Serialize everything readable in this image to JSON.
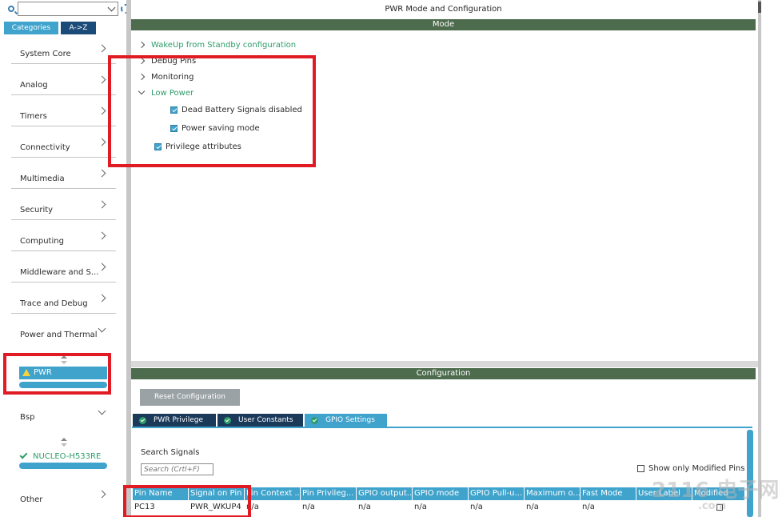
{
  "left": {
    "tabs": [
      "Categories",
      "A->Z"
    ],
    "categories": [
      "System Core",
      "Analog",
      "Timers",
      "Connectivity",
      "Multimedia",
      "Security",
      "Computing",
      "Middleware and S...",
      "Trace and Debug",
      "Power and Thermal"
    ],
    "selected": "PWR",
    "bsp": "Bsp",
    "board": "NUCLEO-H533RE",
    "other": "Other"
  },
  "main": {
    "title": "PWR Mode and Configuration",
    "mode_header": "Mode",
    "tree": {
      "wakeup": "WakeUp from Standby configuration",
      "debug": "Debug Pins",
      "monitoring": "Monitoring",
      "lowpower": "Low Power",
      "dead_battery": "Dead Battery Signals disabled",
      "power_saving": "Power saving mode",
      "privilege": "Privilege attributes"
    },
    "config_header": "Configuration",
    "reset_button": "Reset Configuration",
    "config_tabs": [
      "PWR Privilege",
      "User Constants",
      "GPIO Settings"
    ],
    "search_label": "Search Signals",
    "search_placeholder": "Search (Crtl+F)",
    "show_modified": "Show only Modified Pins",
    "table": {
      "headers": [
        "Pin Name",
        "Signal on Pin",
        "Pin Context ...",
        "Pin Privileg...",
        "GPIO output...",
        "GPIO mode",
        "GPIO Pull-u...",
        "Maximum o...",
        "Fast Mode",
        "User Label",
        "Modified"
      ],
      "rows": [
        [
          "PC13",
          "PWR_WKUP4",
          "n/a",
          "n/a",
          "n/a",
          "n/a",
          "n/a",
          "n/a",
          "n/a",
          "",
          ""
        ]
      ]
    }
  },
  "watermark": {
    "main": "2116 电子网",
    "sub": ".com"
  }
}
